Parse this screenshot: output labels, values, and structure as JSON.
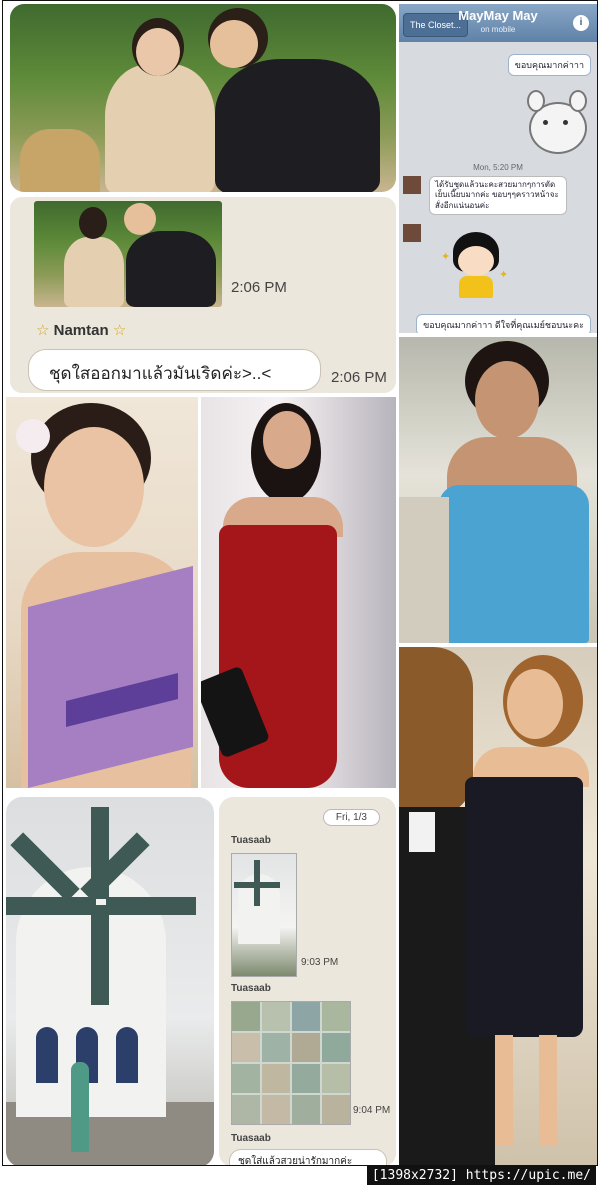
{
  "chat1": {
    "time1": "2:06 PM",
    "name": "Namtan",
    "star": "☆",
    "message": "ชุดใสออกมาแล้วมันเริดค่ะ>..<",
    "time2": "2:06 PM"
  },
  "line_chat": {
    "back_label": "The Closet...",
    "title": "MayMay May",
    "subtitle": "on mobile",
    "info_icon": "i",
    "sent1": "ขอบคุณมากค่าาา",
    "date": "Mon, 5:20 PM",
    "recv1": "ได้รับชุดแล้วนะคะสวยมากๆการตัดเย็บเนี๊ยบมากค่ะ ขอบๆๆคราวหน้าจะสั่งอีกแน่นอนค่ะ",
    "sent2": "ขอบคุณมากค่าาา ดีใจที่คุณเมย์ชอบนะคะ"
  },
  "chat2": {
    "date_chip": "Fri, 1/3",
    "sender1": "Tuasaab",
    "time1": "9:03 PM",
    "sender2": "Tuasaab",
    "time2": "9:04 PM",
    "sender3": "Tuasaab",
    "message": "ชุดใส่แล้วสวยน่ารักมากค่ะ"
  },
  "watermark": "[1398x2732] https://upic.me/",
  "colors": {
    "line_header": "#5f82a8",
    "chat_bg": "#ece7dc",
    "red_dress": "#a5161b",
    "blue_dress": "#4aa3d0",
    "purple_dress": "#a67fc2"
  }
}
